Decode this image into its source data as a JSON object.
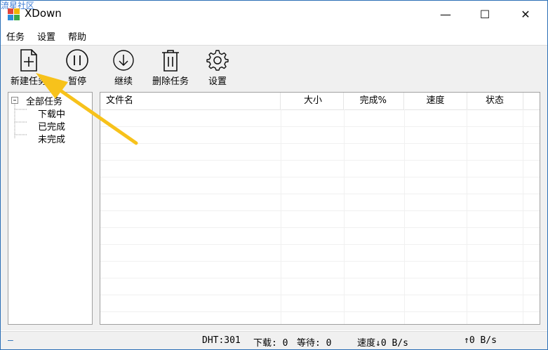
{
  "watermark": "流星社区",
  "window": {
    "title": "XDown",
    "minimize_glyph": "—",
    "maximize_glyph": "☐",
    "close_glyph": "✕"
  },
  "menu": {
    "items": [
      "任务",
      "设置",
      "帮助"
    ]
  },
  "toolbar": {
    "new_task": "新建任务",
    "pause": "暂停",
    "resume": "继续",
    "delete_task": "删除任务",
    "settings": "设置"
  },
  "tree": {
    "root": "全部任务",
    "children": [
      "下载中",
      "已完成",
      "未完成"
    ]
  },
  "table": {
    "columns": [
      "文件名",
      "大小",
      "完成%",
      "速度",
      "状态"
    ],
    "rows": []
  },
  "status": {
    "left": "—",
    "dht": "DHT:301",
    "downloading": "下载: 0",
    "waiting": "等待: 0",
    "down_speed": "速度↓0 B/s",
    "up_speed": "↑0 B/s"
  },
  "colors": {
    "accent_arrow": "#f7c21b",
    "window_border": "#2b6fb6"
  }
}
